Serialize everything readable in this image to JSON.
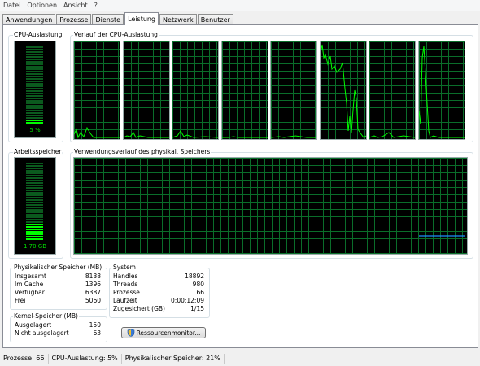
{
  "menu": [
    "Datei",
    "Optionen",
    "Ansicht",
    "?"
  ],
  "tabs": [
    "Anwendungen",
    "Prozesse",
    "Dienste",
    "Leistung",
    "Netzwerk",
    "Benutzer"
  ],
  "active_tab": 3,
  "cpu": {
    "title": "CPU-Auslastung",
    "value": "5 %",
    "level": 0.05
  },
  "cpu_history": {
    "title": "Verlauf der CPU-Auslastung",
    "cores": 8
  },
  "memory": {
    "title": "Arbeitsspeicher",
    "value": "1,70 GB",
    "level": 0.21
  },
  "memory_history": {
    "title": "Verwendungsverlauf des physikal. Speichers"
  },
  "physical": {
    "title": "Physikalischer Speicher (MB)",
    "rows": [
      {
        "label": "Insgesamt",
        "value": "8138"
      },
      {
        "label": "Im Cache",
        "value": "1396"
      },
      {
        "label": "Verfügbar",
        "value": "6387"
      },
      {
        "label": "Frei",
        "value": "5060"
      }
    ]
  },
  "kernel": {
    "title": "Kernel-Speicher (MB)",
    "rows": [
      {
        "label": "Ausgelagert",
        "value": "150"
      },
      {
        "label": "Nicht ausgelagert",
        "value": "63"
      }
    ]
  },
  "system": {
    "title": "System",
    "rows": [
      {
        "label": "Handles",
        "value": "18892"
      },
      {
        "label": "Threads",
        "value": "980"
      },
      {
        "label": "Prozesse",
        "value": "66"
      },
      {
        "label": "Laufzeit",
        "value": "0:00:12:09"
      },
      {
        "label": "Zugesichert (GB)",
        "value": "1/15"
      }
    ]
  },
  "resource_button": "Ressourcenmonitor...",
  "status": {
    "processes": "Prozesse: 66",
    "cpu": "CPU-Auslastung: 5%",
    "memory": "Physikalischer Speicher: 21%"
  },
  "colors": {
    "graph_line": "#00ff00",
    "grid": "#0a6d2a",
    "memory_line": "#1e90ff"
  }
}
